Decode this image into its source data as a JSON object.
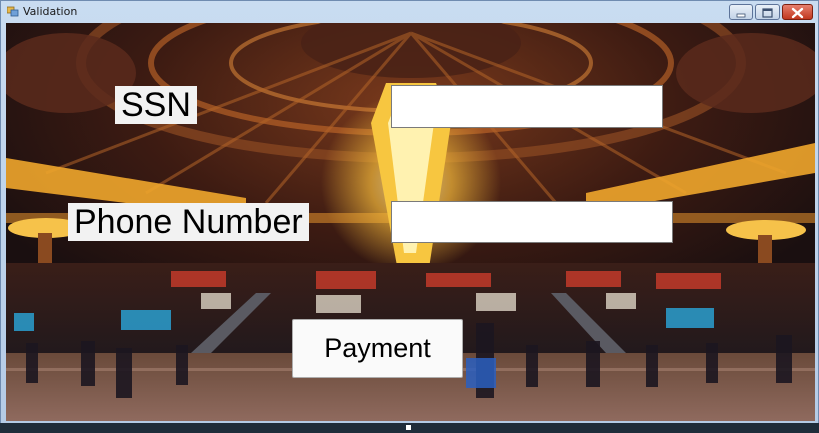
{
  "window": {
    "title": "Validation"
  },
  "form": {
    "ssn_label": "SSN",
    "ssn_value": "",
    "phone_label": "Phone Number",
    "phone_value": "",
    "payment_button": "Payment"
  },
  "icons": {
    "app": "app-icon",
    "minimize": "minimize-icon",
    "maximize": "maximize-icon",
    "close": "close-icon"
  },
  "colors": {
    "close_button": "#c1381f",
    "title_bar": "#c9dcf1",
    "background_warm": "#e39a2d"
  }
}
